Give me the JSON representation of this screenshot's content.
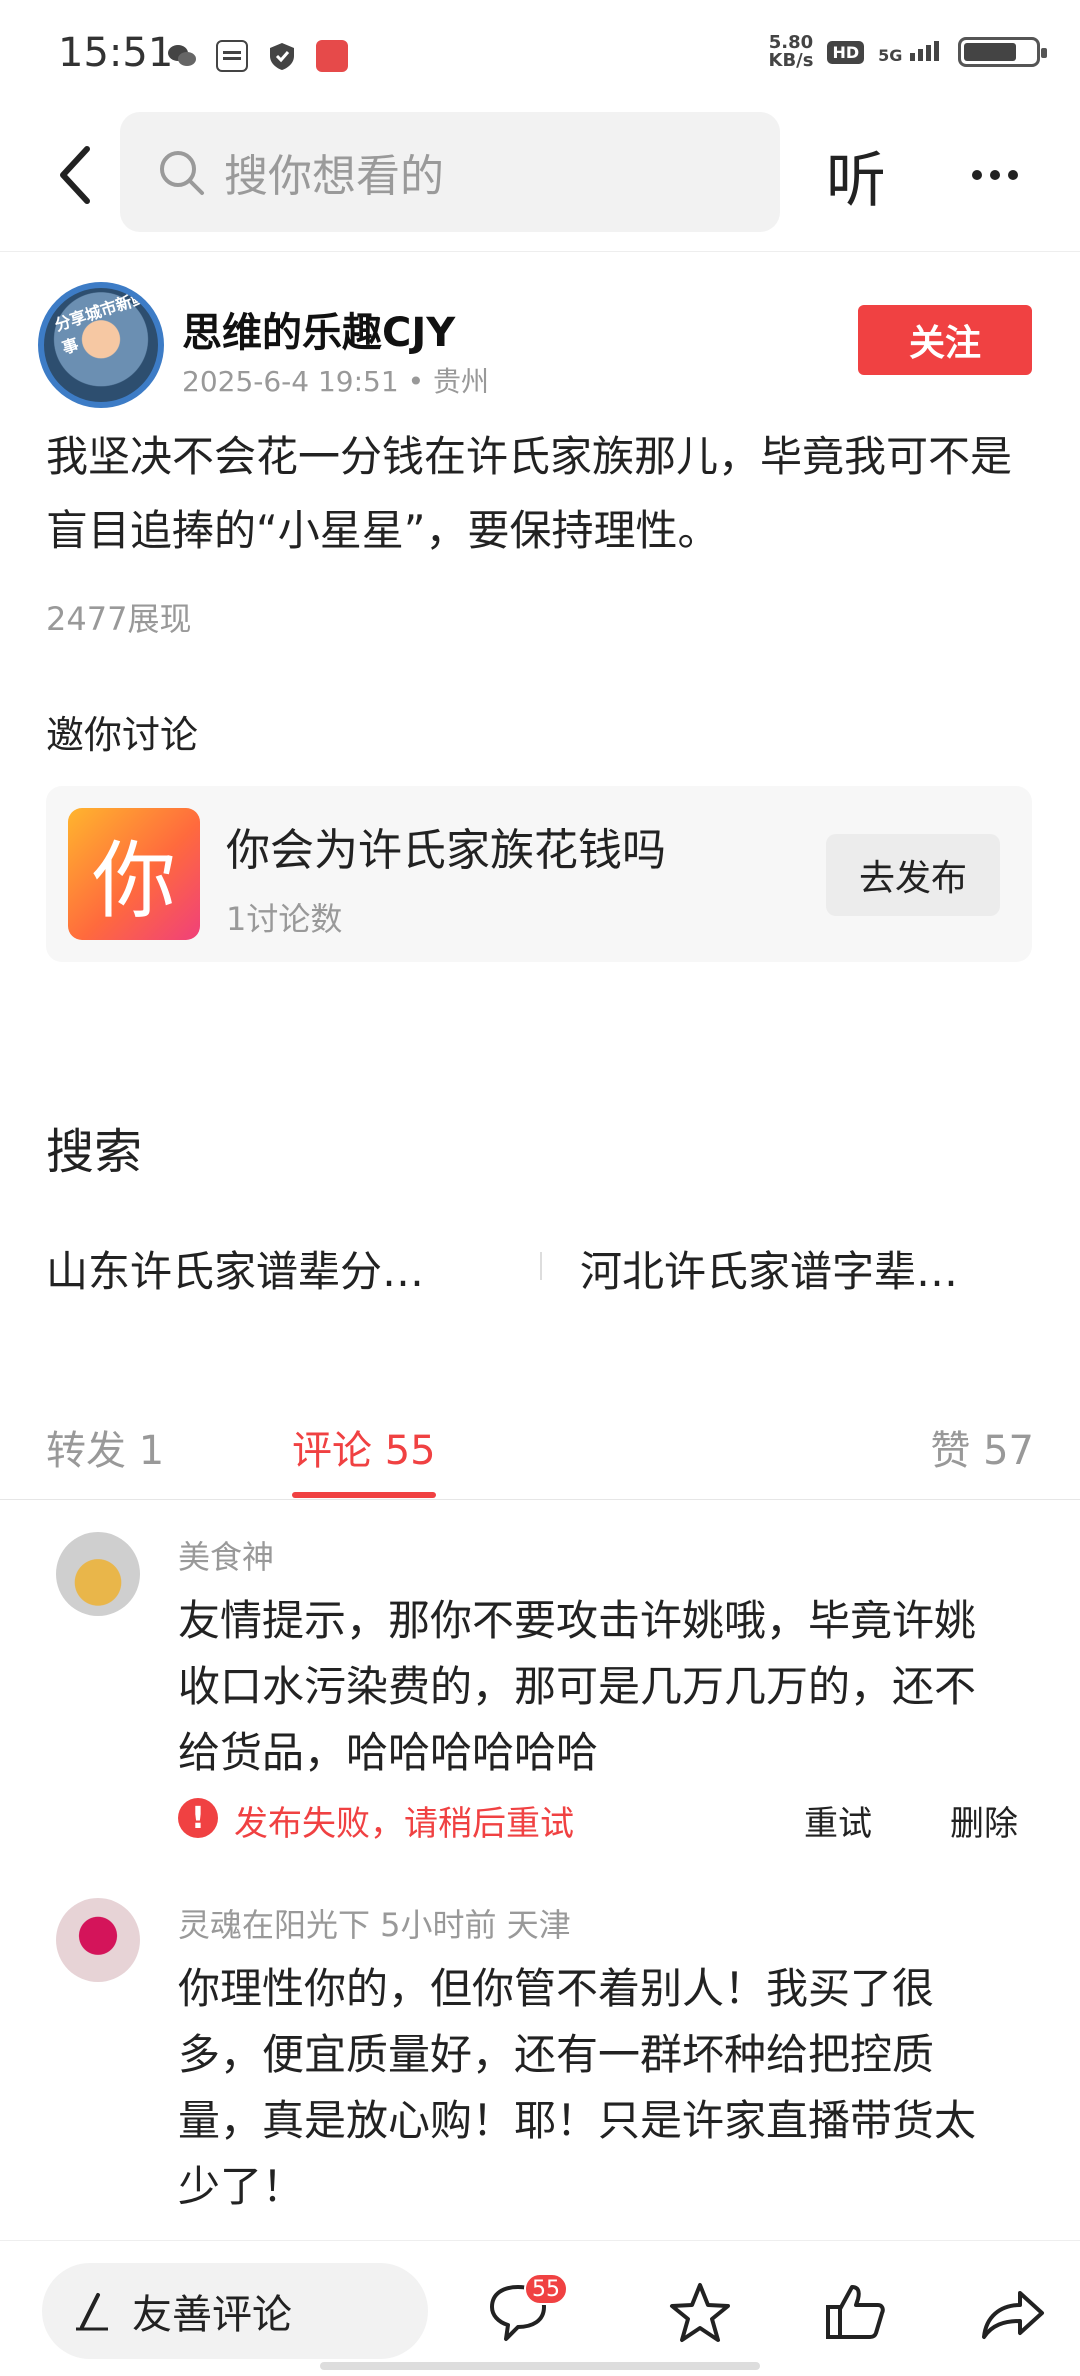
{
  "status_bar": {
    "time": "15:51",
    "speed_value": "5.80",
    "speed_unit": "KB/s",
    "hd": "HD",
    "network": "5G",
    "left_icons": [
      "wechat-icon",
      "toutiao-icon",
      "shield-icon",
      "app-icon"
    ]
  },
  "nav": {
    "search_placeholder": "搜你想看的",
    "listen_label": "听"
  },
  "post": {
    "author_name": "思维的乐趣CJY",
    "avatar_text": "分享城市新鲜事",
    "meta": "2025-6-4 19:51 • 贵州",
    "follow_label": "关注",
    "body": "我坚决不会花一分钱在许氏家族那儿，毕竟我可不是盲目追捧的“小星星”，要保持理性。",
    "views": "2477展现"
  },
  "discussion": {
    "title": "邀你讨论",
    "topic_icon_text": "你",
    "topic_title": "你会为许氏家族花钱吗",
    "topic_count": "1讨论数",
    "topic_button": "去发布"
  },
  "search": {
    "title": "搜索",
    "suggestions": [
      "山东许氏家谱辈分…",
      "河北许氏家谱字辈…"
    ]
  },
  "tabs": {
    "repost": "转发 1",
    "comment": "评论 55",
    "like": "赞 57"
  },
  "comments": [
    {
      "name": "美食神",
      "text": "友情提示，那你不要攻击许姚哦，毕竟许姚收口水污染费的，那可是几万几万的，还不给货品，哈哈哈哈哈哈",
      "fail_icon": "!",
      "fail_text": "发布失败，请稍后重试",
      "retry": "重试",
      "delete": "删除"
    },
    {
      "name": "灵魂在阳光下  5小时前  天津",
      "text": "你理性你的，但你管不着别人！我买了很多，便宜质量好，还有一群坏种给把控质量，真是放心购！耶！只是许家直播带货太少了！"
    }
  ],
  "bottom_bar": {
    "comment_placeholder": "友善评论",
    "comment_badge": "55"
  },
  "colors": {
    "accent": "#f04142",
    "muted": "#999999"
  }
}
